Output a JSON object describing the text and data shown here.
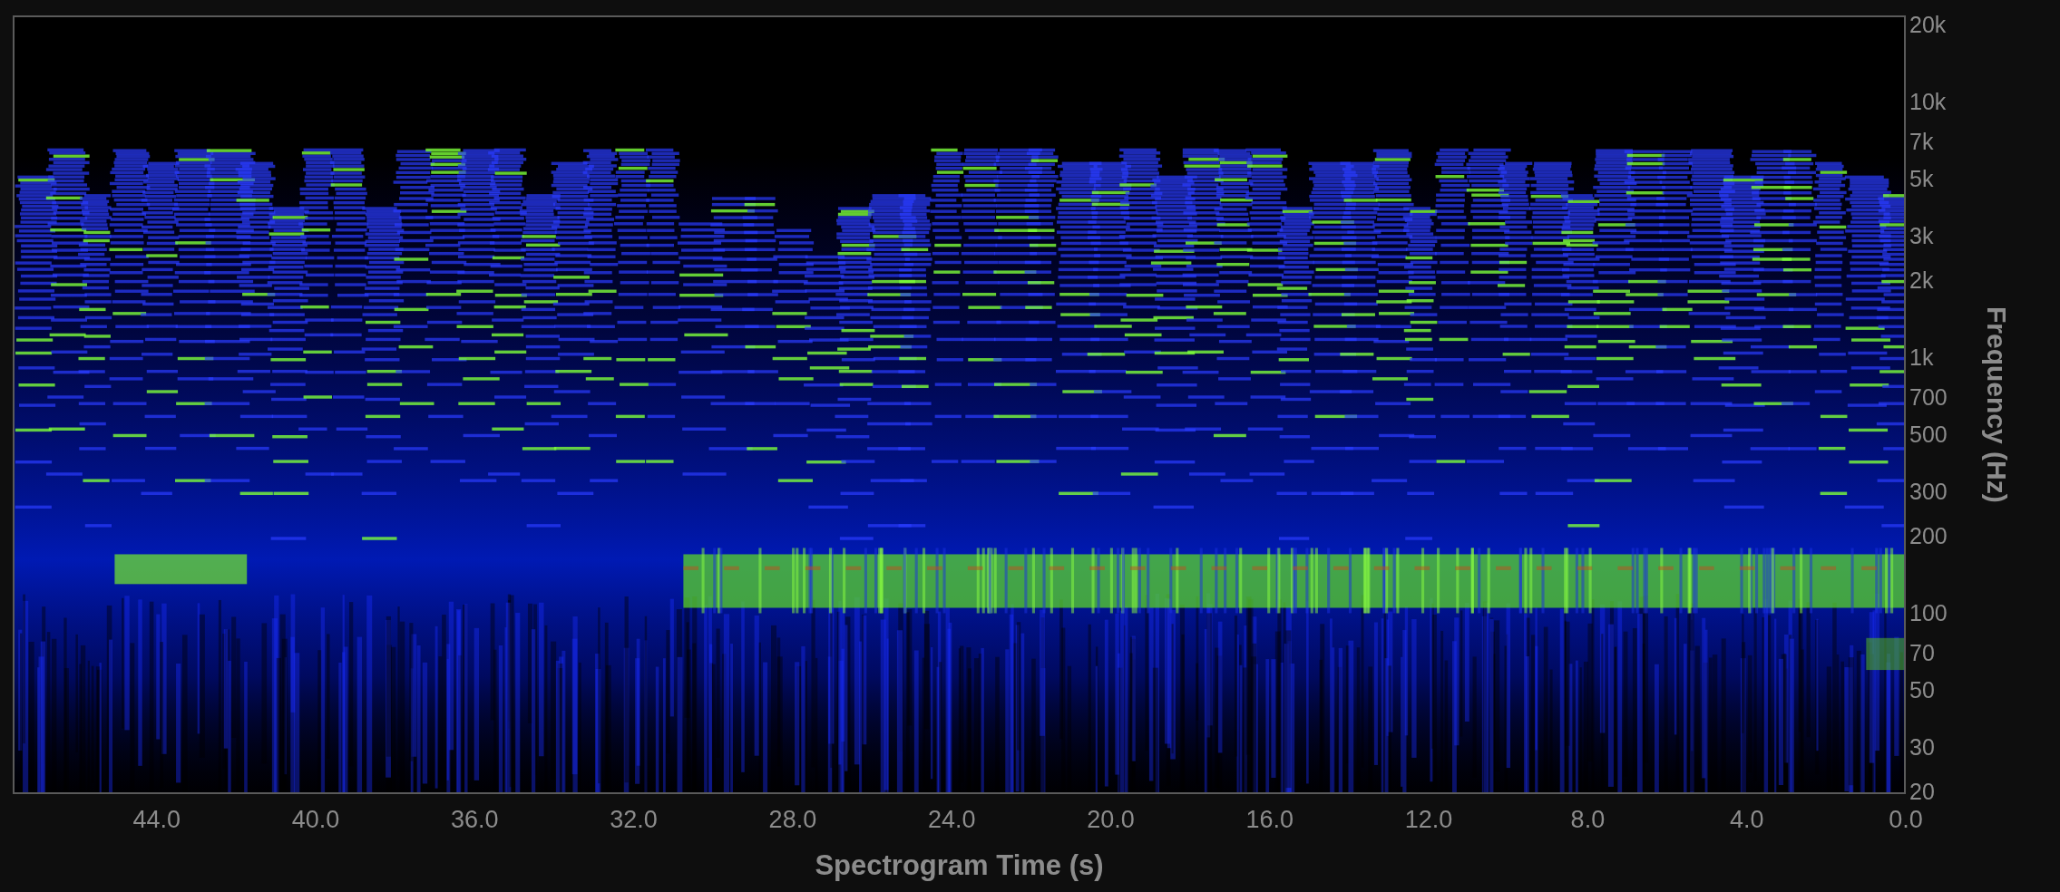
{
  "spectrogram": {
    "x_axis": {
      "ticks": [
        "44.0",
        "40.0",
        "36.0",
        "32.0",
        "28.0",
        "24.0",
        "20.0",
        "16.0",
        "12.0",
        "8.0",
        "4.0",
        "0.0"
      ],
      "title": "Spectrogram Time (s)"
    },
    "y_axis": {
      "ticks": [
        "20k",
        "10k",
        "7k",
        "5k",
        "3k",
        "2k",
        "1k",
        "700",
        "500",
        "300",
        "200",
        "100",
        "70",
        "50",
        "30",
        "20"
      ],
      "title": "Frequency (Hz)"
    }
  }
}
